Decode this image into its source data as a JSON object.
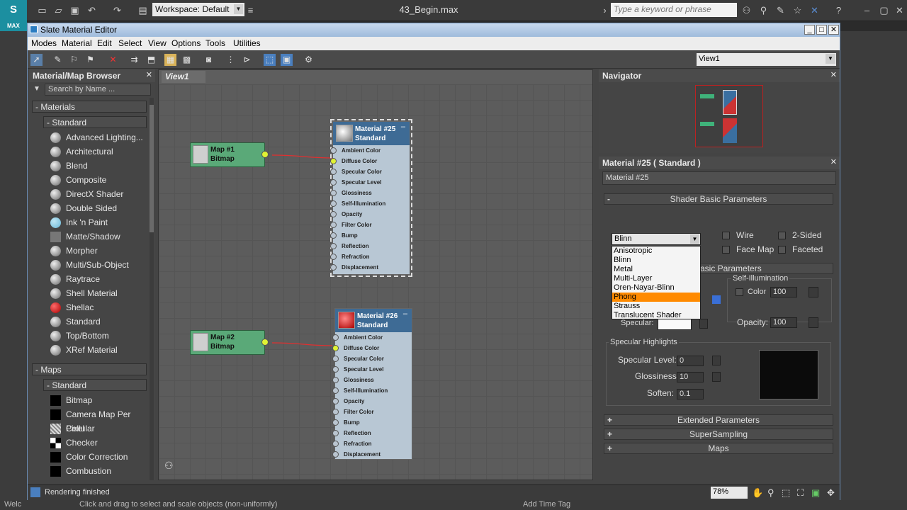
{
  "top": {
    "workspace_label": "Workspace: Default",
    "file_title": "43_Begin.max",
    "search_placeholder": "Type a keyword or phrase",
    "logo_text": "MAX"
  },
  "window": {
    "title": "Slate Material Editor",
    "menus": [
      "Modes",
      "Material",
      "Edit",
      "Select",
      "View",
      "Options",
      "Tools",
      "Utilities"
    ],
    "view_selector": "View1"
  },
  "browser": {
    "title": "Material/Map Browser",
    "search_placeholder": "Search by Name ...",
    "materials_header": "- Materials",
    "standard_header": "- Standard",
    "materials": [
      "Advanced Lighting...",
      "Architectural",
      "Blend",
      "Composite",
      "DirectX Shader",
      "Double Sided",
      "Ink 'n Paint",
      "Matte/Shadow",
      "Morpher",
      "Multi/Sub-Object",
      "Raytrace",
      "Shell Material",
      "Shellac",
      "Standard",
      "Top/Bottom",
      "XRef Material"
    ],
    "maps_header": "- Maps",
    "maps_standard_header": "- Standard",
    "maps": [
      "Bitmap",
      "Camera Map Per Pixel",
      "Cellular",
      "Checker",
      "Color Correction",
      "Combustion"
    ]
  },
  "view": {
    "tab": "View1",
    "map1": {
      "name": "Map #1",
      "type": "Bitmap"
    },
    "map2": {
      "name": "Map #2",
      "type": "Bitmap"
    },
    "mat1": {
      "name": "Material #25",
      "type": "Standard"
    },
    "mat2": {
      "name": "Material #26",
      "type": "Standard"
    },
    "slots": [
      "Ambient Color",
      "Diffuse Color",
      "Specular Color",
      "Specular Level",
      "Glossiness",
      "Self-Illumination",
      "Opacity",
      "Filter Color",
      "Bump",
      "Reflection",
      "Refraction",
      "Displacement"
    ]
  },
  "navigator": {
    "title": "Navigator"
  },
  "props": {
    "title": "Material #25  ( Standard )",
    "name_value": "Material #25",
    "shader_basic": "Shader Basic Parameters",
    "shader_selected": "Blinn",
    "shader_options": [
      "Anisotropic",
      "Blinn",
      "Metal",
      "Multi-Layer",
      "Oren-Nayar-Blinn",
      "Phong",
      "Strauss",
      "Translucent Shader"
    ],
    "wire": "Wire",
    "two_sided": "2-Sided",
    "face_map": "Face Map",
    "faceted": "Faceted",
    "basic_params": "asic Parameters",
    "self_illum": "Self-Illumination",
    "color": "Color",
    "color_val": "100",
    "specular": "Specular:",
    "opacity": "Opacity:",
    "opacity_val": "100",
    "spec_highlights": "Specular Highlights",
    "spec_level": "Specular Level:",
    "spec_level_val": "0",
    "glossiness": "Glossiness:",
    "glossiness_val": "10",
    "soften": "Soften:",
    "soften_val": "0.1",
    "extended": "Extended Parameters",
    "supersampling": "SuperSampling",
    "maps": "Maps"
  },
  "status": {
    "text": "Rendering finished",
    "zoom": "78%"
  },
  "bottom": {
    "hint": "Click and drag to select and scale objects (non-uniformly)",
    "welcome": "Welc",
    "addtag": "Add Time Tag"
  }
}
